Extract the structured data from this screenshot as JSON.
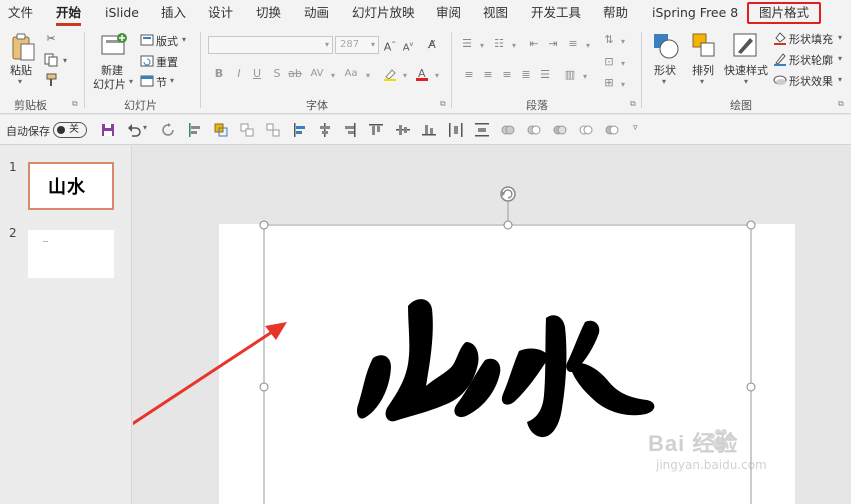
{
  "menu": {
    "tabs": [
      "文件",
      "开始",
      "iSlide",
      "插入",
      "设计",
      "切换",
      "动画",
      "幻灯片放映",
      "审阅",
      "视图",
      "开发工具",
      "帮助",
      "iSpring Free 8",
      "图片格式"
    ],
    "active_tab": "开始",
    "highlighted_tab": "图片格式"
  },
  "ribbon": {
    "clipboard": {
      "label": "剪贴板",
      "paste": "粘贴"
    },
    "slides": {
      "label": "幻灯片",
      "new_slide": "新建",
      "new_slide_2": "幻灯片",
      "layout": "版式",
      "reset": "重置",
      "section": "节"
    },
    "font": {
      "label": "字体",
      "font_size": "287"
    },
    "paragraph": {
      "label": "段落"
    },
    "drawing": {
      "label": "绘图",
      "shapes": "形状",
      "arrange": "排列",
      "quick_styles": "快速样式",
      "shape_fill": "形状填充",
      "shape_outline": "形状轮廓",
      "shape_effects": "形状效果"
    }
  },
  "qat": {
    "autosave": "自动保存",
    "toggle": "关"
  },
  "thumbnails": [
    {
      "number": "1",
      "text": "山水"
    },
    {
      "number": "2",
      "text": ""
    }
  ],
  "slide": {
    "calligraphy": "山水"
  },
  "watermark": {
    "brand": "Bai 经验",
    "url": "jingyan.baidu.com"
  },
  "colors": {
    "accent": "#c43e1c",
    "highlight_box": "#e02020",
    "arrow": "#e8352a"
  }
}
